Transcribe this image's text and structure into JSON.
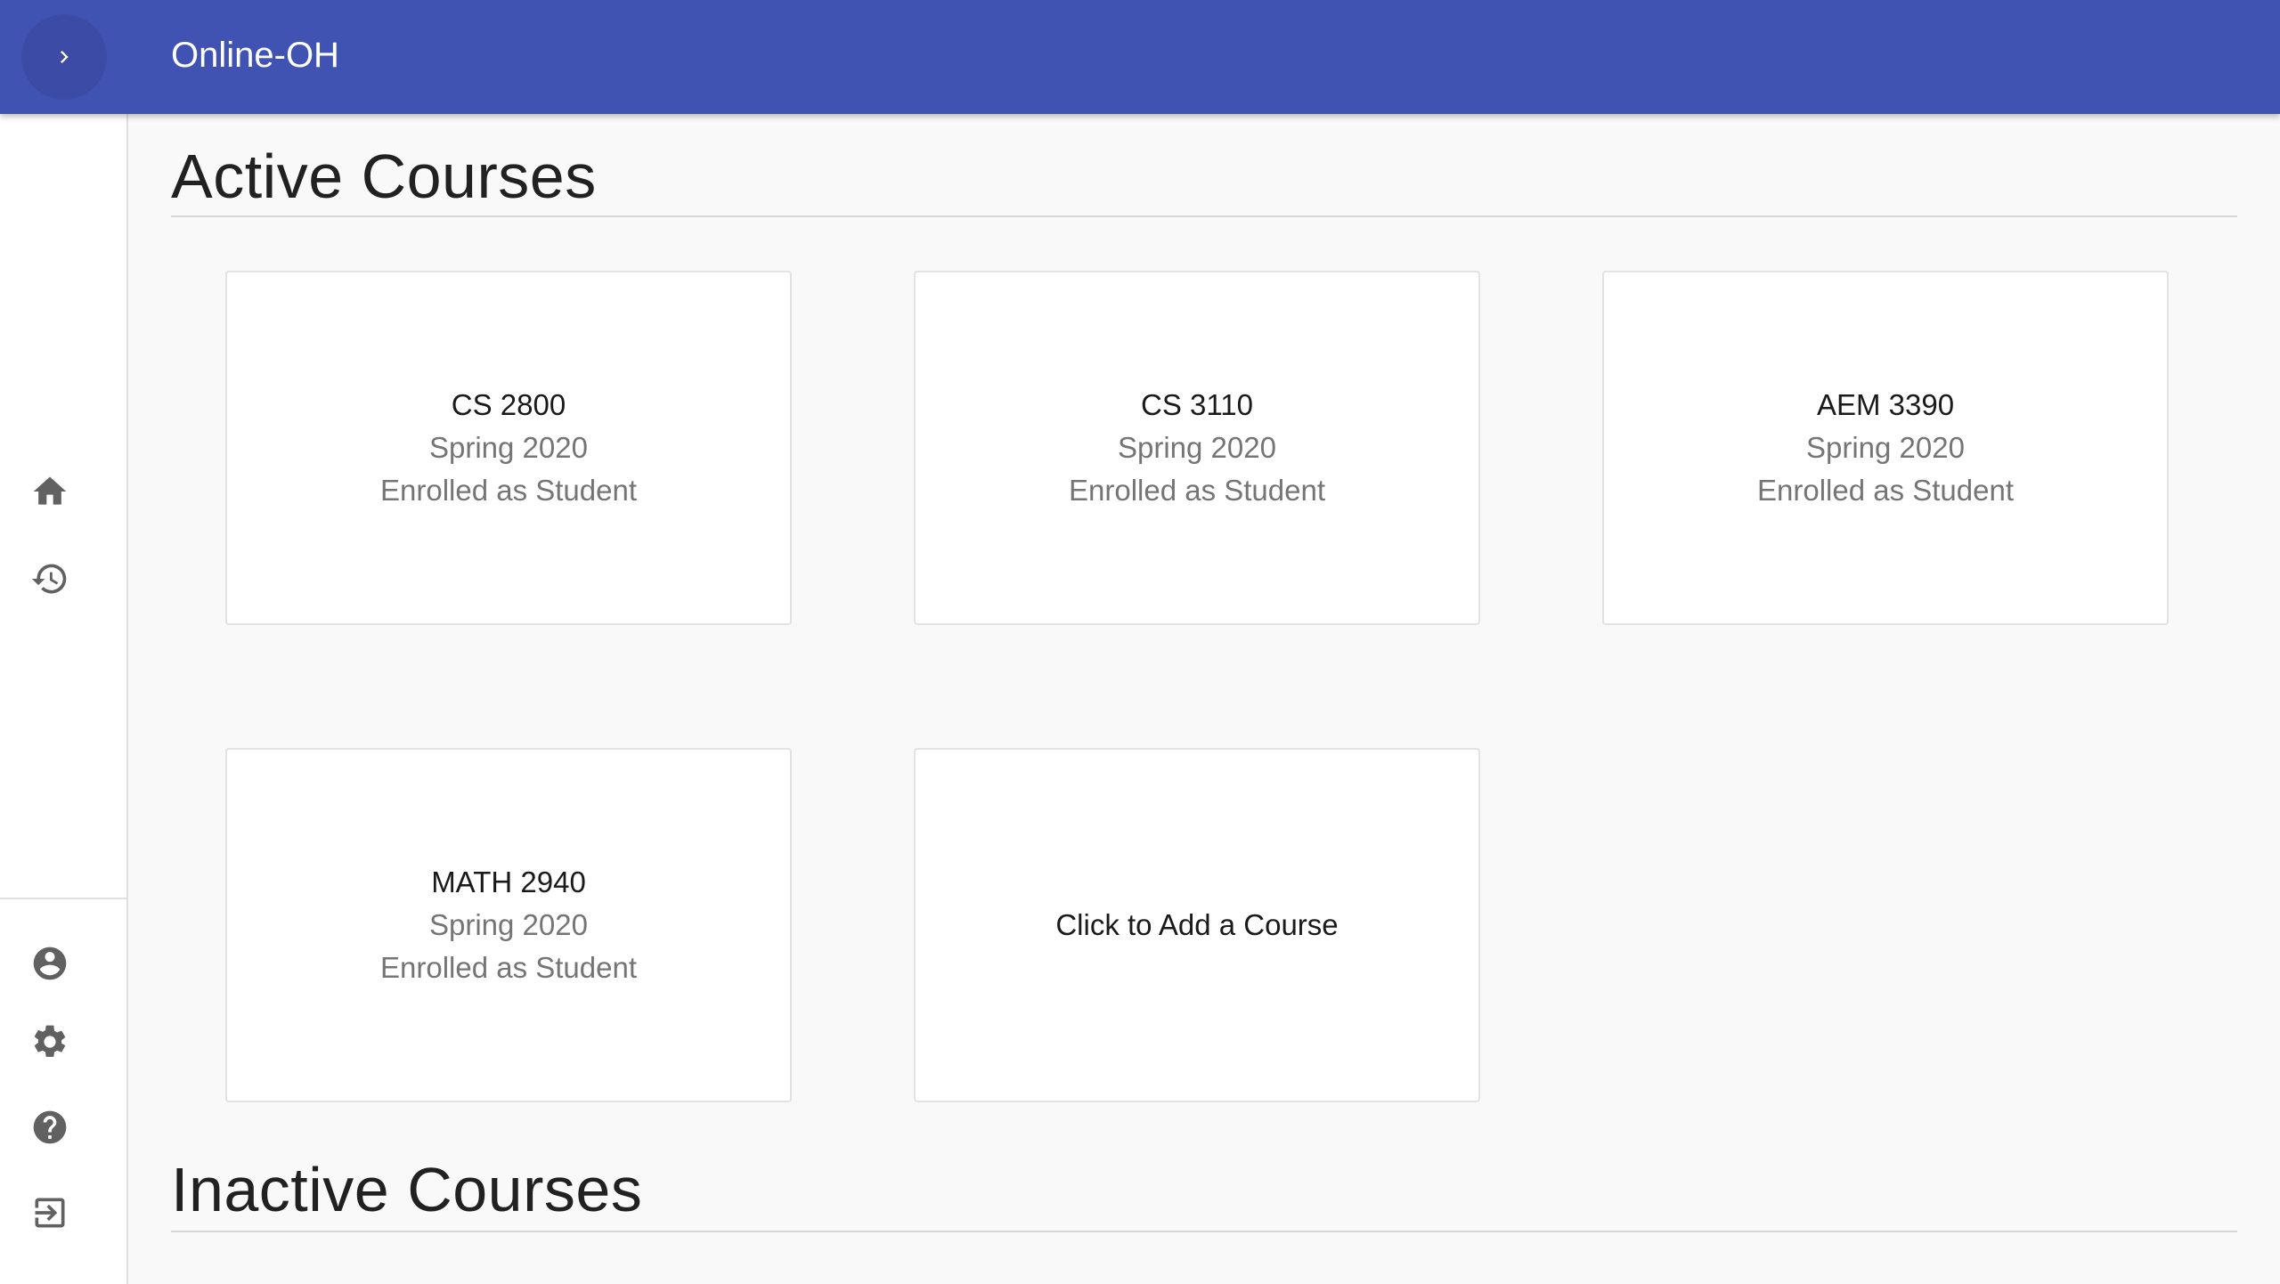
{
  "app": {
    "title": "Online-OH"
  },
  "colors": {
    "appbar": "#4153b2",
    "icon": "#616161"
  },
  "sidebar": {
    "top_icons": [
      "home-icon",
      "history-icon"
    ],
    "bottom_icons": [
      "account-icon",
      "settings-icon",
      "help-icon",
      "logout-icon"
    ]
  },
  "sections": {
    "active_title": "Active Courses",
    "inactive_title": "Inactive Courses"
  },
  "courses": [
    {
      "code": "CS 2800",
      "term": "Spring 2020",
      "role": "Enrolled as Student"
    },
    {
      "code": "CS 3110",
      "term": "Spring 2020",
      "role": "Enrolled as Student"
    },
    {
      "code": "AEM 3390",
      "term": "Spring 2020",
      "role": "Enrolled as Student"
    },
    {
      "code": "MATH 2940",
      "term": "Spring 2020",
      "role": "Enrolled as Student"
    }
  ],
  "add_course": {
    "label": "Click to Add a Course"
  }
}
